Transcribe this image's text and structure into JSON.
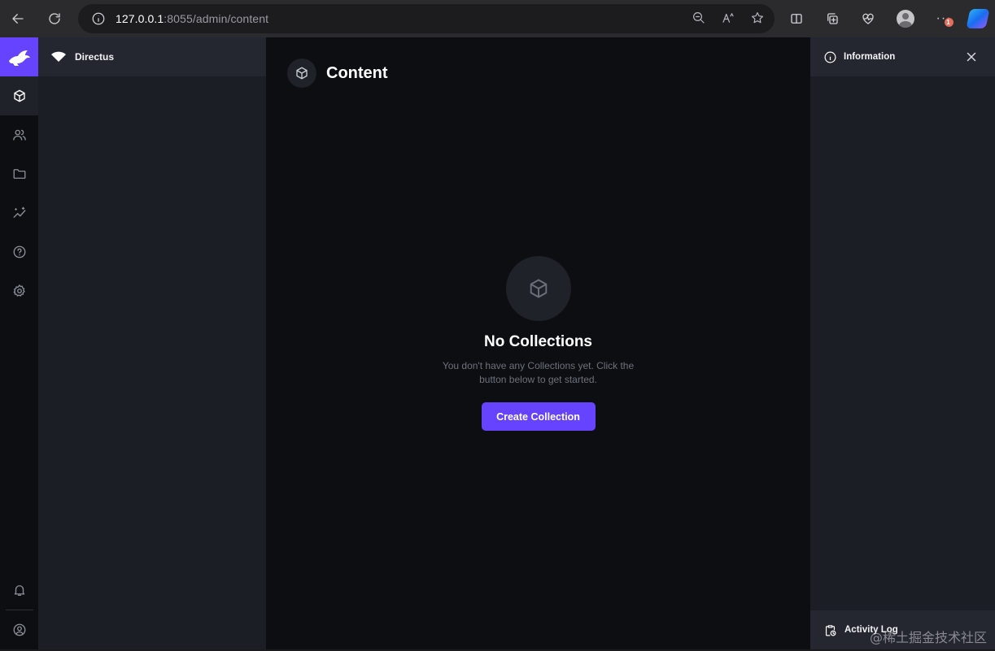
{
  "browser": {
    "url_host": "127.0.0.1",
    "url_rest": ":8055/admin/content",
    "extension_badge": "1"
  },
  "project": {
    "name": "Directus"
  },
  "modules": [
    {
      "name": "content",
      "icon": "cube-icon",
      "active": true
    },
    {
      "name": "users",
      "icon": "users-icon"
    },
    {
      "name": "files",
      "icon": "folder-icon"
    },
    {
      "name": "insights",
      "icon": "insights-icon"
    },
    {
      "name": "help",
      "icon": "help-icon"
    },
    {
      "name": "settings",
      "icon": "gear-icon"
    }
  ],
  "header": {
    "title": "Content"
  },
  "empty_state": {
    "title": "No Collections",
    "text": "You don't have any Collections yet. Click the button below to get started.",
    "button": "Create Collection"
  },
  "sidebar": {
    "info_title": "Information",
    "activity_log": "Activity Log"
  },
  "watermark": "@稀土掘金技术社区",
  "colors": {
    "accent": "#6644ff",
    "background": "#0c0e12",
    "panel": "#1b1e25"
  }
}
